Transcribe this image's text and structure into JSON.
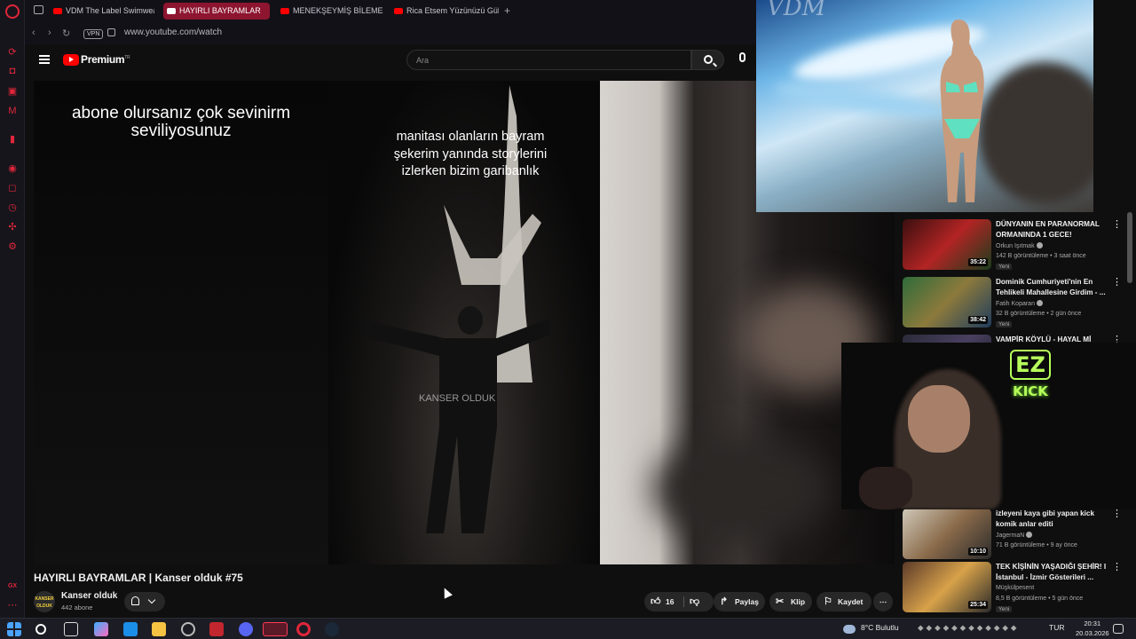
{
  "browser": {
    "tabs": [
      {
        "label": "VDM The Label Swimwear",
        "active": false
      },
      {
        "label": "HAYIRLI BAYRAMLAR",
        "active": true
      },
      {
        "label": "MENEKŞEYMİŞ BİLEMEM",
        "active": false
      },
      {
        "label": "Rica Etsem Yüzünüzü Gül",
        "active": false
      }
    ],
    "vpn_label": "VPN",
    "url": "www.youtube.com/watch",
    "sidebar_gx": "GX"
  },
  "youtube": {
    "logo_label": "Premium",
    "logo_sup": "TR",
    "search_placeholder": "Ara"
  },
  "video": {
    "caption_left": "abone olursanız çok sevinirm seviliyosunuz",
    "caption_center": "manitası olanların bayram şekerim yanında storylerini izlerken bizim garibanlık",
    "watermark": "KANSER OLDUK",
    "title": "HAYIRLI BAYRAMLAR | Kanser olduk #75",
    "channel": {
      "name": "Kanser olduk",
      "subs": "442 abone",
      "avatar_text": "KANSER OLDUK"
    },
    "likes": "16",
    "share_label": "Paylaş",
    "clip_label": "Klip",
    "save_label": "Kaydet"
  },
  "overlay": {
    "fashion_mark": "VDM"
  },
  "recommendations": [
    {
      "title": "DÜNYANIN EN PARANORMAL ORMANINDA 1 GECE!",
      "channel": "Orkun Işıtmak",
      "meta": "142 B görüntüleme • 3 saat önce",
      "badge": "Yeni",
      "duration": "35:22",
      "thumb": [
        "#3a0f0f",
        "#b32424",
        "#1a3d1c"
      ]
    },
    {
      "title": "Dominik Cumhuriyeti'nin En Tehlikeli Mahallesine Girdim - ...",
      "channel": "Fatih Koparan",
      "meta": "32 B görüntüleme • 2 gün önce",
      "badge": "Yeni",
      "duration": "38:42",
      "thumb": [
        "#2f6b3a",
        "#8c7a3c",
        "#1f3c5c"
      ]
    },
    {
      "title": "VAMPİR KÖYLÜ - HAYAL Mİ",
      "channel": "",
      "meta": "",
      "badge": "",
      "duration": "",
      "thumb": [
        "#2a2a38",
        "#494060",
        "#1a1a22"
      ]
    },
    {
      "title": "izleyeni kaya gibi yapan kick komik anlar editi",
      "channel": "JagermaN",
      "meta": "71 B görüntüleme • 9 ay önce",
      "badge": "",
      "duration": "10:10",
      "thumb": [
        "#cfc8b8",
        "#8a6a4a",
        "#2b2b2b"
      ]
    },
    {
      "title": "TEK KİŞİNİN YAŞADIĞI ŞEHİR! I İstanbul - İzmir Gösterileri ...",
      "channel": "Müşkülpesent",
      "meta": "8,5 B görüntüleme • 5 gün önce",
      "badge": "Yeni",
      "duration": "25:34",
      "thumb": [
        "#5b3a2a",
        "#d8a24a",
        "#2a2a2a"
      ]
    }
  ],
  "webcam": {
    "overlay_top": "EZ",
    "overlay_bottom": "KICK"
  },
  "taskbar": {
    "weather": "8°C  Bulutlu",
    "lang": "TUR",
    "time": "20:31",
    "date": "20.03.2026"
  },
  "colors": {
    "accent": "#e0263a",
    "youtube_red": "#ff0000",
    "active_tab": "#8d1530",
    "kick_green": "#b7ff5a"
  }
}
